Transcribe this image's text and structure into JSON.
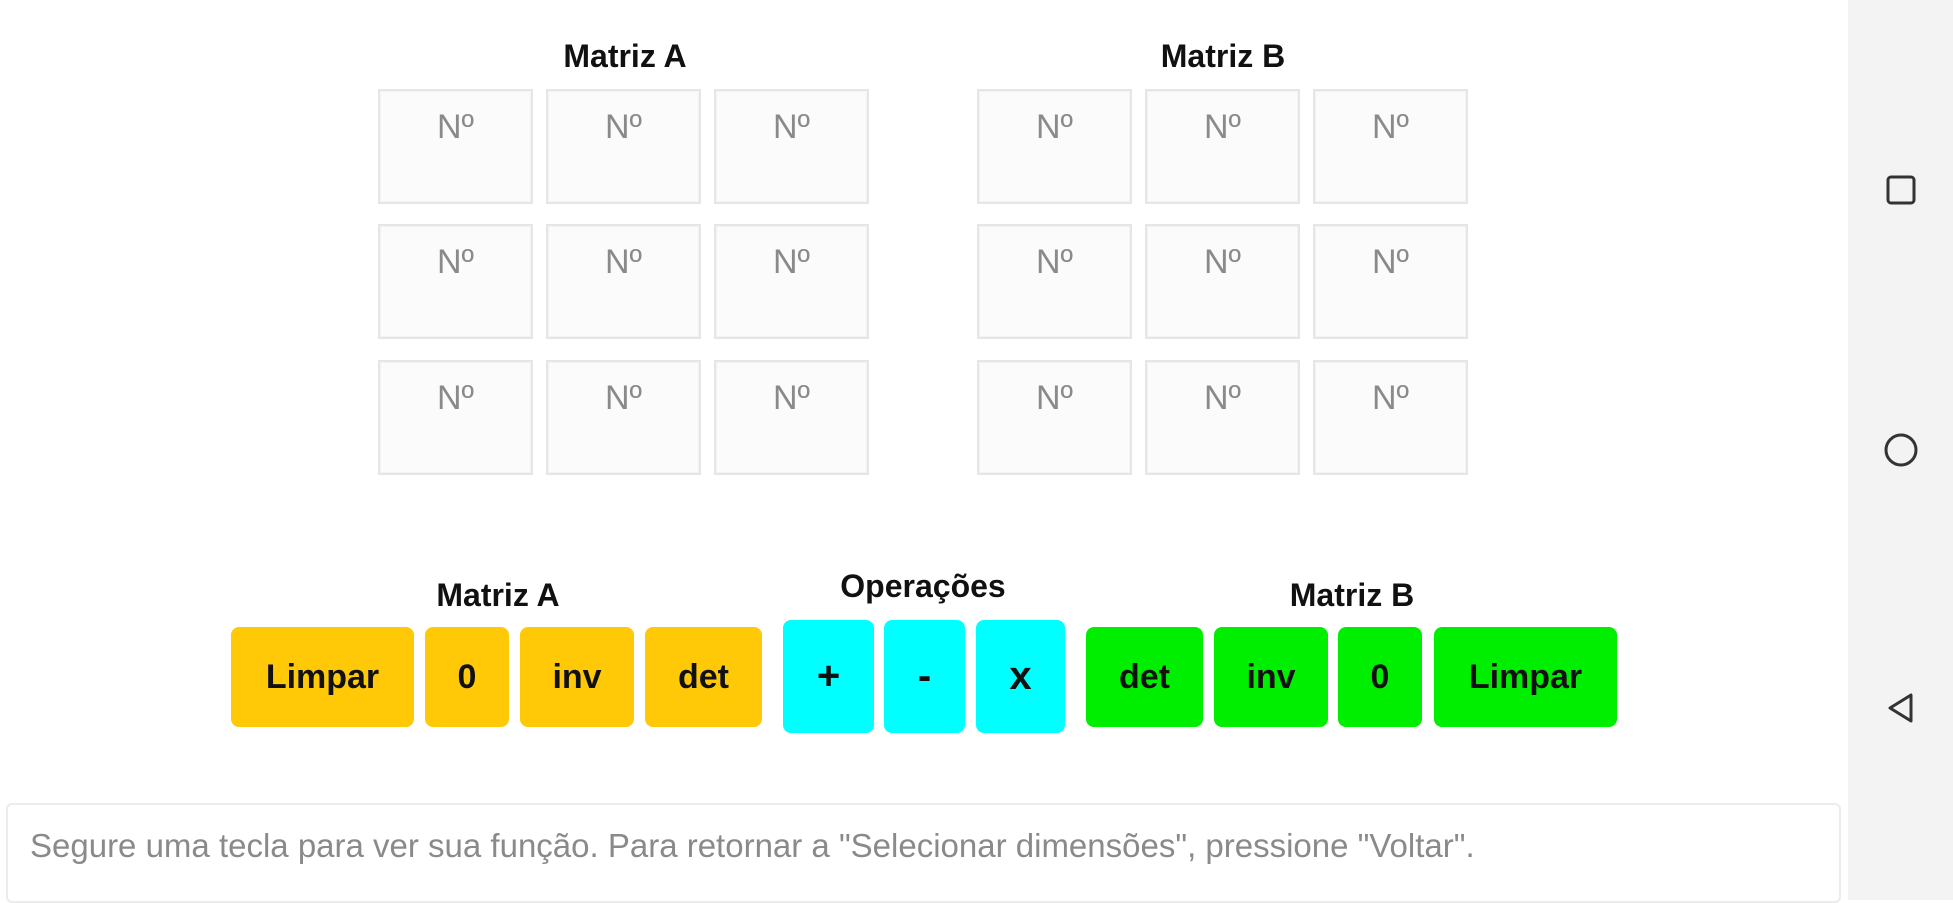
{
  "matrices": {
    "a": {
      "title": "Matriz A",
      "cells": [
        [
          "",
          "",
          ""
        ],
        [
          "",
          "",
          ""
        ],
        [
          "",
          "",
          ""
        ]
      ],
      "placeholder": "Nº"
    },
    "b": {
      "title": "Matriz B",
      "cells": [
        [
          "",
          "",
          ""
        ],
        [
          "",
          "",
          ""
        ],
        [
          "",
          "",
          ""
        ]
      ],
      "placeholder": "Nº"
    }
  },
  "keyboard": {
    "matrix_a": {
      "label": "Matriz A",
      "clear": "Limpar",
      "zero": "0",
      "inverse": "inv",
      "determinant": "det",
      "color": "#ffc907"
    },
    "operations": {
      "label": "Operações",
      "add": "+",
      "subtract": "-",
      "multiply": "x",
      "color": "#00ffff"
    },
    "matrix_b": {
      "label": "Matriz B",
      "determinant": "det",
      "inverse": "inv",
      "zero": "0",
      "clear": "Limpar",
      "color": "#00ee00"
    }
  },
  "hint": {
    "text": "Segure uma tecla para ver sua função. Para retornar a \"Selecionar dimensões\", pressione \"Voltar\"."
  },
  "navigation": {
    "icons": [
      "recent-apps-icon",
      "home-icon",
      "back-icon"
    ]
  }
}
